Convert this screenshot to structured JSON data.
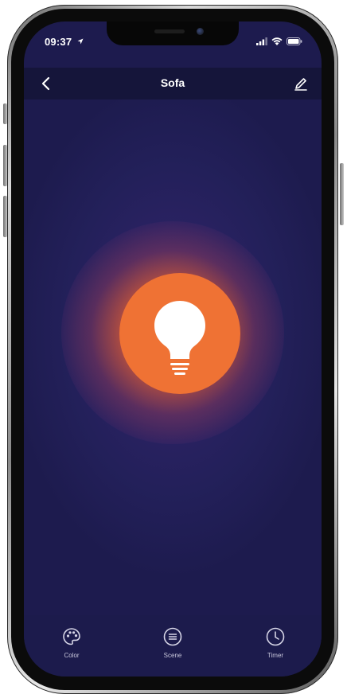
{
  "status_bar": {
    "time": "09:37"
  },
  "nav": {
    "title": "Sofa"
  },
  "device": {
    "power_state": "on",
    "accent_color": "#ef7234"
  },
  "tabs": [
    {
      "label": "Color",
      "icon": "palette-icon"
    },
    {
      "label": "Scene",
      "icon": "scene-icon"
    },
    {
      "label": "Timer",
      "icon": "clock-icon"
    }
  ],
  "colors": {
    "background": "#221f58",
    "nav_background": "#15153a",
    "tab_background": "#1c1b4c",
    "bulb_circle": "#ef7234",
    "icon_white": "#ffffff"
  }
}
